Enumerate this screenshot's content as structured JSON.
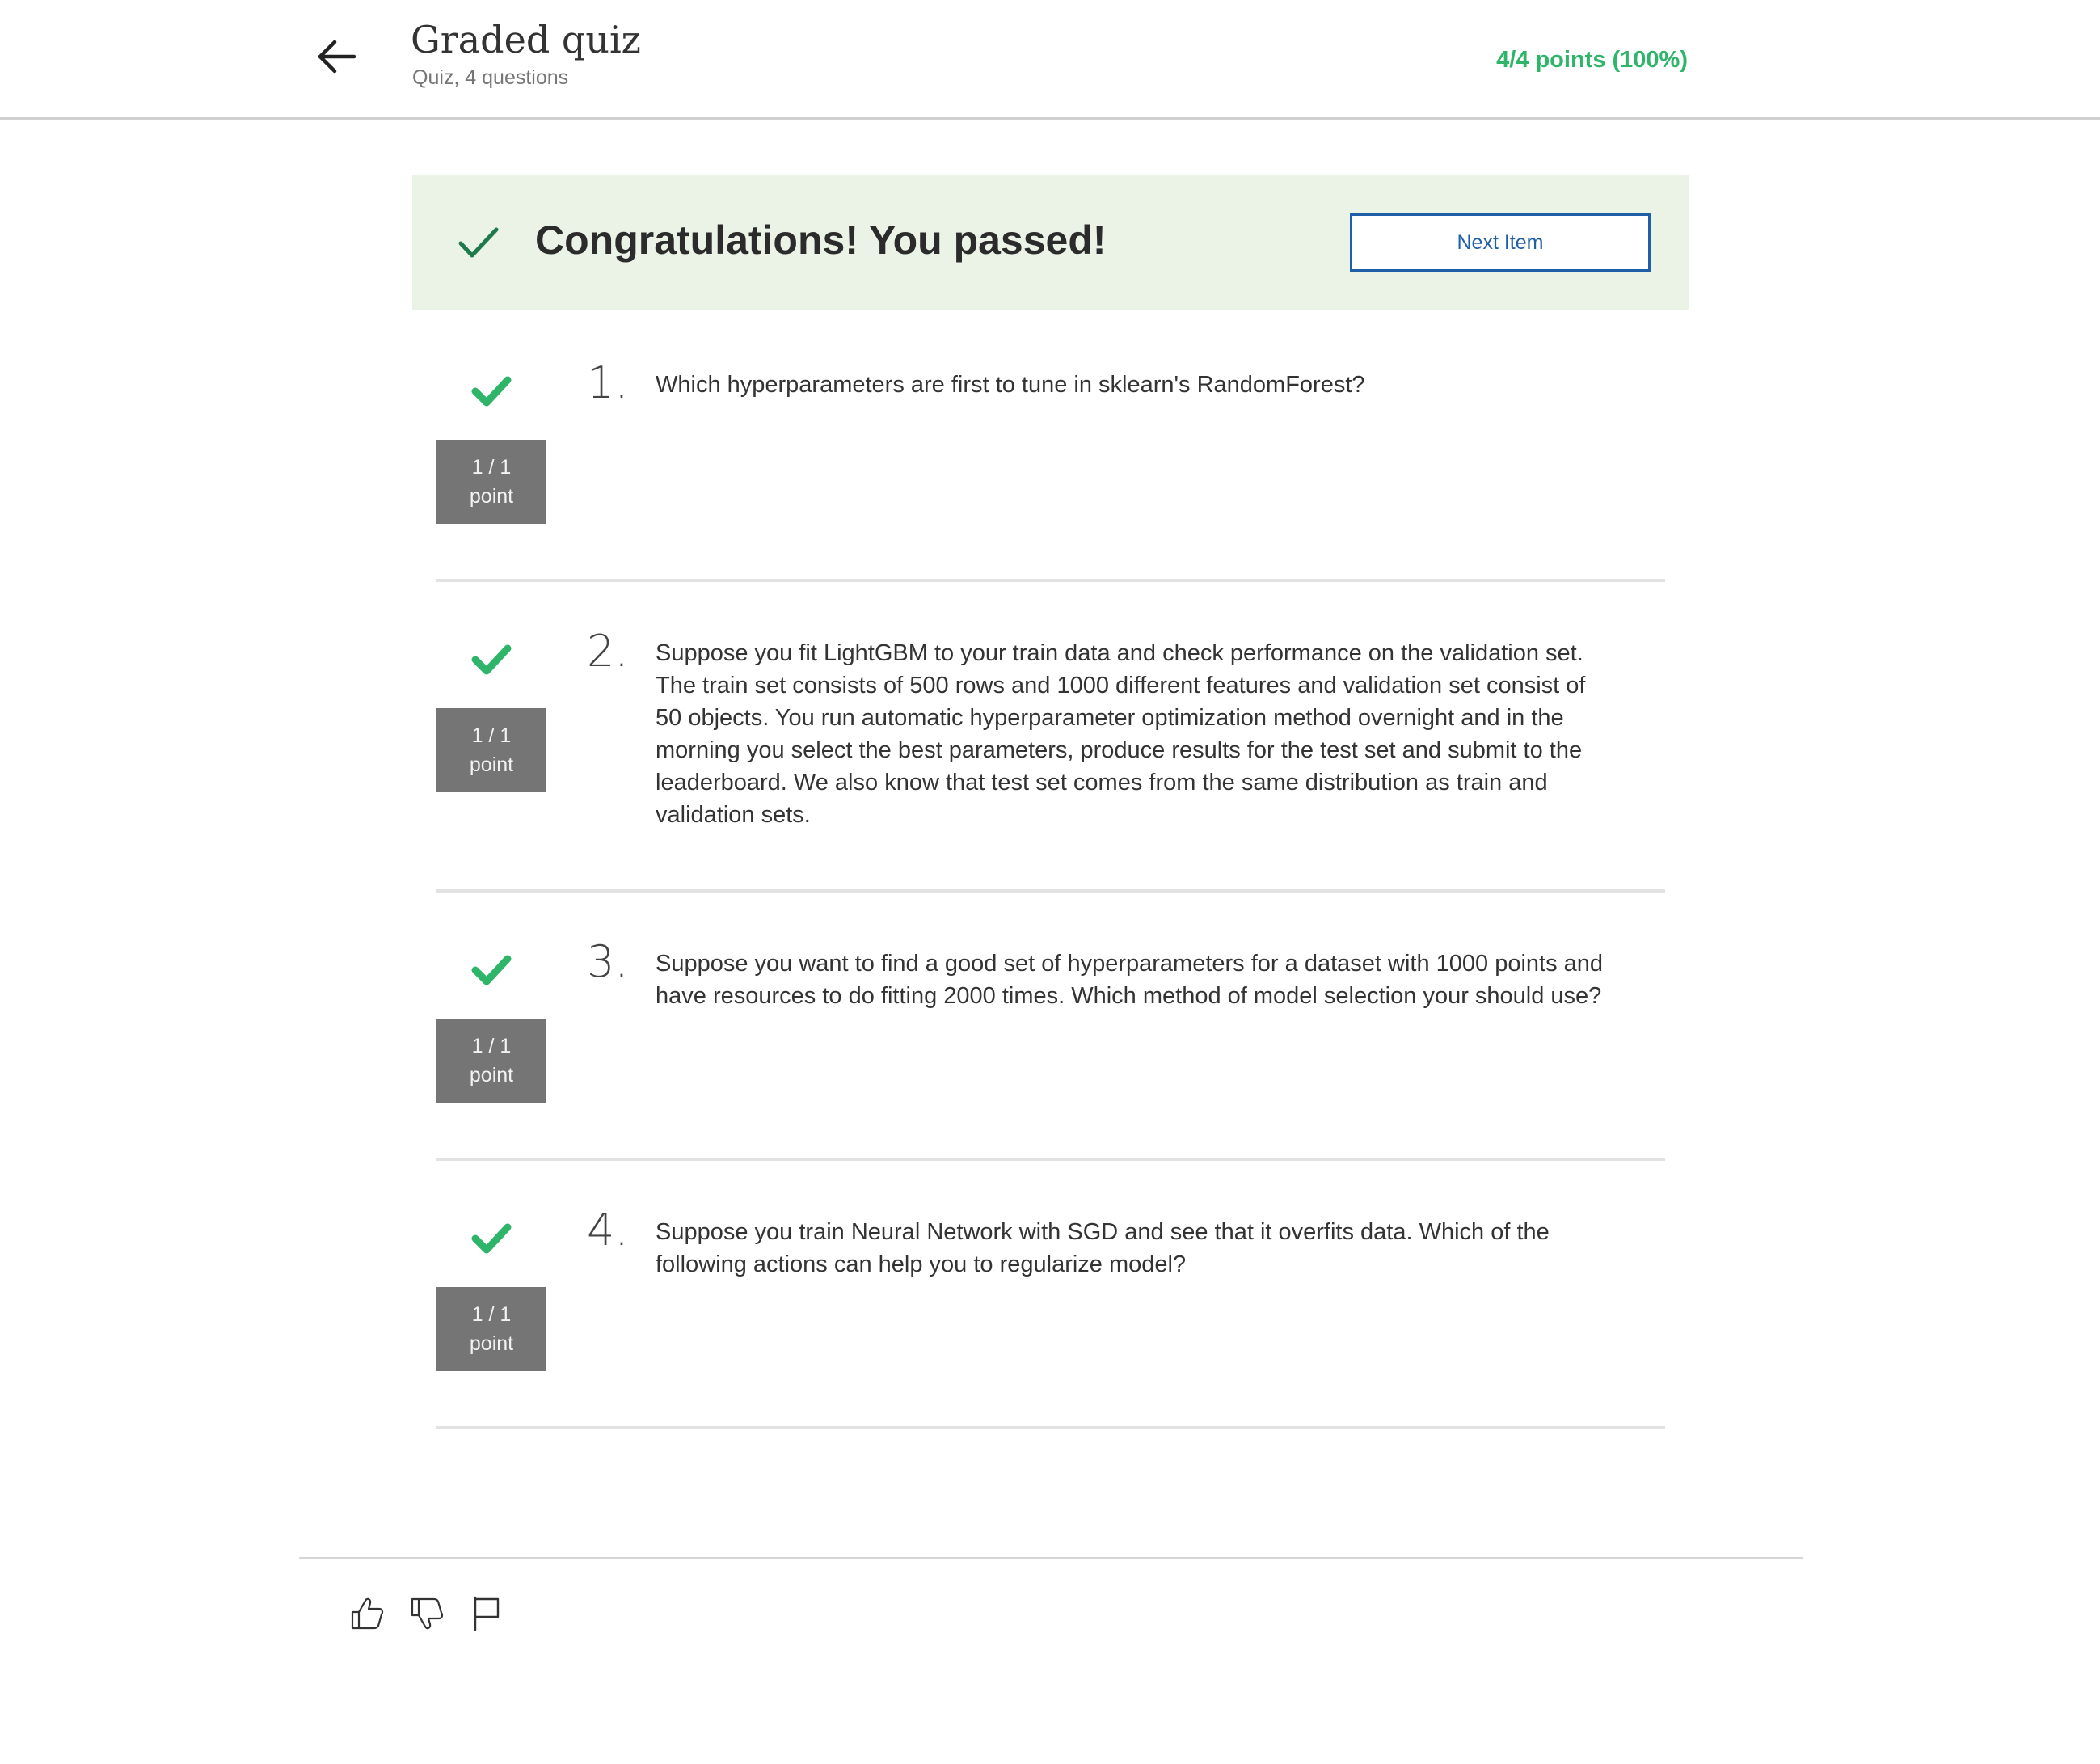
{
  "header": {
    "title": "Graded quiz",
    "subtitle": "Quiz, 4 questions",
    "score": "4/4 points (100%)",
    "back_icon": "arrow-left-icon"
  },
  "banner": {
    "message": "Congratulations! You passed!",
    "next_button_label": "Next Item",
    "check_icon": "check-icon"
  },
  "questions": [
    {
      "number": "1.",
      "points_line1": "1 / 1",
      "points_line2": "point",
      "status": "correct",
      "text": "Which hyperparameters are first to tune in sklearn's RandomForest?"
    },
    {
      "number": "2.",
      "points_line1": "1 / 1",
      "points_line2": "point",
      "status": "correct",
      "text": "Suppose you fit LightGBM to your train data and check performance on the validation set. The train set consists of 500 rows and 1000 different features and validation set consist of 50 objects. You run automatic hyperparameter optimization method overnight and in the morning you select the best parameters, produce results for the test set and submit to the leaderboard. We also know that test set comes from the same distribution as train and validation sets."
    },
    {
      "number": "3.",
      "points_line1": "1 / 1",
      "points_line2": "point",
      "status": "correct",
      "text": "Suppose you want to find a good set of hyperparameters for a dataset with 1000 points and have resources to do fitting 2000 times. Which method of model selection your should use?"
    },
    {
      "number": "4.",
      "points_line1": "1 / 1",
      "points_line2": "point",
      "status": "correct",
      "text": "Suppose you train Neural Network with SGD and see that it overfits data. Which of the following actions can help you to regularize model?"
    }
  ],
  "footer": {
    "icons": [
      "thumbs-up-icon",
      "thumbs-down-icon",
      "flag-icon"
    ]
  },
  "colors": {
    "accent_green": "#2eb56a",
    "banner_bg": "#eaf3e6",
    "link_blue": "#1f5fa8",
    "badge_gray": "#757575"
  }
}
